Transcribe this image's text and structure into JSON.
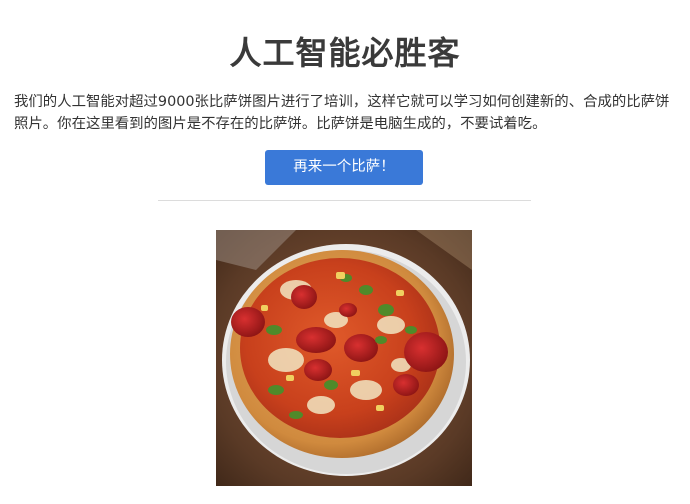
{
  "header": {
    "title": "人工智能必胜客"
  },
  "intro": {
    "text": "我们的人工智能对超过9000张比萨饼图片进行了培训，这样它就可以学习如何创建新的、合成的比萨饼照片。你在这里看到的图片是不存在的比萨饼。比萨饼是电脑生成的，不要试着吃。"
  },
  "actions": {
    "another_pizza_label": "再来一个比萨！"
  },
  "colors": {
    "button": "#3a79d8",
    "title": "#3a3a3a",
    "divider": "#dcdcdc"
  }
}
